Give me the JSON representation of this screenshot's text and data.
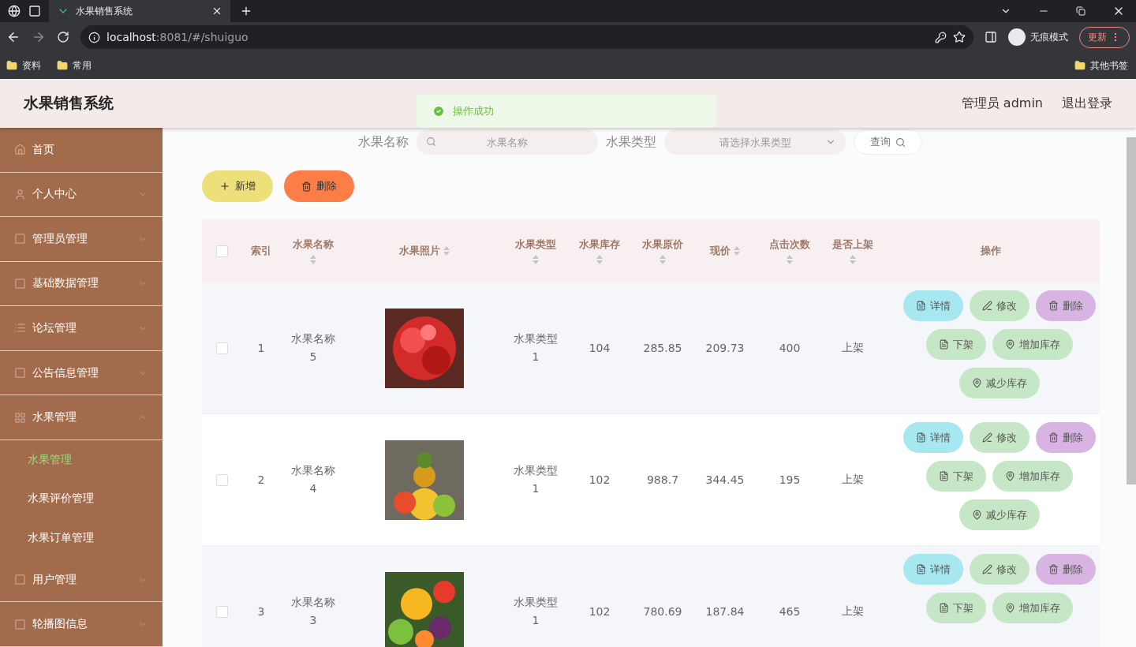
{
  "browser": {
    "tabs": [
      {
        "title": "水果销售系统",
        "selected": true
      }
    ],
    "url_host": "localhost",
    "url_path": ":8081/#/shuiguo",
    "incognito_label": "无痕模式",
    "update_label": "更新",
    "bookmarks": [
      "资料",
      "常用"
    ],
    "other_bookmarks": "其他书签"
  },
  "app": {
    "title": "水果销售系统",
    "user": "管理员 admin",
    "logout": "退出登录",
    "toast": "操作成功"
  },
  "sidebar": {
    "items": [
      {
        "label": "首页",
        "expanded": false
      },
      {
        "label": "个人中心",
        "expanded": false
      },
      {
        "label": "管理员管理",
        "expanded": false
      },
      {
        "label": "基础数据管理",
        "expanded": false
      },
      {
        "label": "论坛管理",
        "expanded": false
      },
      {
        "label": "公告信息管理",
        "expanded": false
      },
      {
        "label": "水果管理",
        "expanded": true,
        "children": [
          {
            "label": "水果管理",
            "selected": true
          },
          {
            "label": "水果评价管理",
            "selected": false
          },
          {
            "label": "水果订单管理",
            "selected": false
          }
        ]
      },
      {
        "label": "用户管理",
        "expanded": false
      },
      {
        "label": "轮播图信息",
        "expanded": false
      }
    ]
  },
  "search": {
    "fields": [
      {
        "label": "水果名称",
        "kind": "input",
        "placeholder": "水果名称"
      },
      {
        "label": "水果类型",
        "kind": "select",
        "placeholder": "请选择水果类型"
      }
    ],
    "button": "查询"
  },
  "toolbar": [
    {
      "label": "新增",
      "kind": "add"
    },
    {
      "label": "删除",
      "kind": "delete"
    }
  ],
  "table": {
    "select_all_checked": false,
    "columns": [
      {
        "label": "索引",
        "sortable": false
      },
      {
        "label": "水果名称",
        "sortable": true
      },
      {
        "label": "水果照片",
        "sortable": true
      },
      {
        "label": "水果类型",
        "sortable": true
      },
      {
        "label": "水果库存",
        "sortable": true
      },
      {
        "label": "水果原价",
        "sortable": true
      },
      {
        "label": "现价",
        "sortable": true
      },
      {
        "label": "点击次数",
        "sortable": true
      },
      {
        "label": "是否上架",
        "sortable": true
      },
      {
        "label": "操作",
        "sortable": false
      }
    ],
    "rows": [
      {
        "checked": false,
        "index": "1",
        "name": "水果名称5",
        "photo": {
          "kind": "picture"
        },
        "type": "水果类型1",
        "stock": "104",
        "original_price": "285.85",
        "price": "209.73",
        "clicks": "400",
        "status": "上架",
        "actions": [
          {
            "label": "详情",
            "kind": "detail"
          },
          {
            "label": "修改",
            "kind": "edit"
          },
          {
            "label": "删除",
            "kind": "delete"
          },
          {
            "label": "下架",
            "kind": "off"
          },
          {
            "label": "增加库存",
            "kind": "add_stock"
          },
          {
            "label": "减少库存",
            "kind": "reduce_stock"
          }
        ]
      },
      {
        "checked": false,
        "index": "2",
        "name": "水果名称4",
        "photo": {
          "kind": "picture"
        },
        "type": "水果类型1",
        "stock": "102",
        "original_price": "988.7",
        "price": "344.45",
        "clicks": "195",
        "status": "上架",
        "actions": [
          {
            "label": "详情",
            "kind": "detail"
          },
          {
            "label": "修改",
            "kind": "edit"
          },
          {
            "label": "删除",
            "kind": "delete"
          },
          {
            "label": "下架",
            "kind": "off"
          },
          {
            "label": "增加库存",
            "kind": "add_stock"
          },
          {
            "label": "减少库存",
            "kind": "reduce_stock"
          }
        ]
      },
      {
        "checked": false,
        "index": "3",
        "name": "水果名称3",
        "photo": {
          "kind": "picture"
        },
        "type": "水果类型1",
        "stock": "102",
        "original_price": "780.69",
        "price": "187.84",
        "clicks": "465",
        "status": "上架",
        "actions": [
          {
            "label": "详情",
            "kind": "detail"
          },
          {
            "label": "修改",
            "kind": "edit"
          },
          {
            "label": "删除",
            "kind": "delete"
          },
          {
            "label": "下架",
            "kind": "off"
          },
          {
            "label": "增加库存",
            "kind": "add_stock"
          }
        ]
      }
    ]
  }
}
